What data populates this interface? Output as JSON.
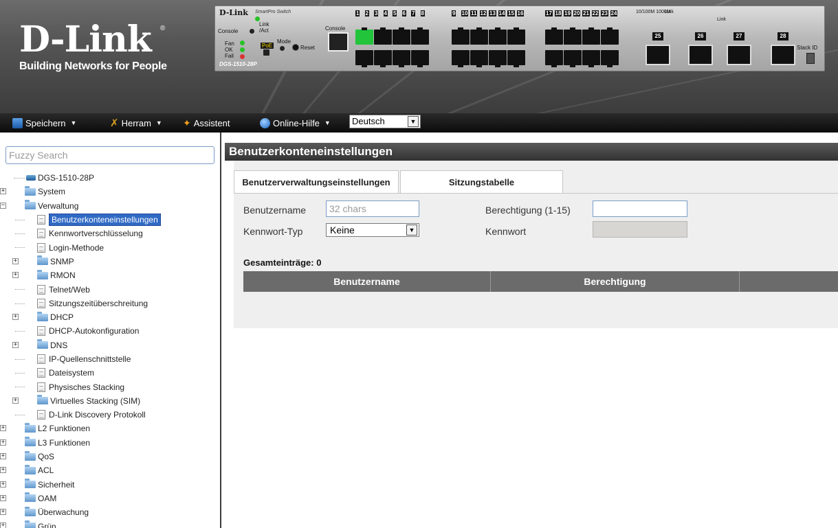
{
  "header": {
    "logo": "D-Link",
    "logo_tagline": "Building Networks for People",
    "panel_brand": "D-Link",
    "panel_brand_sub": "SmartPro Switch",
    "model": "DGS-1510-28P",
    "labels": {
      "console": "Console",
      "link": "Link",
      "act": "/Act",
      "fan": "Fan",
      "ok": "OK",
      "fail": "Fail",
      "poe": "PoE",
      "mode": "Mode",
      "reset": "Reset",
      "console_port": "Console",
      "stack_id": "Stack ID"
    },
    "port_numbers": [
      "1",
      "2",
      "3",
      "4",
      "5",
      "6",
      "7",
      "8",
      "9",
      "10",
      "11",
      "12",
      "13",
      "14",
      "15",
      "16",
      "17",
      "18",
      "19",
      "20",
      "21",
      "22",
      "23",
      "24"
    ],
    "sfp_numbers": [
      "25",
      "26",
      "27",
      "28"
    ]
  },
  "toolbar": {
    "save": "Speichern",
    "tools": "Herram",
    "wizard": "Assistent",
    "help": "Online-Hilfe",
    "language": "Deutsch"
  },
  "sidebar": {
    "search_placeholder": "Fuzzy Search",
    "root": "DGS-1510-28P",
    "items": [
      {
        "label": "System",
        "level": 0,
        "type": "folder",
        "expander": "+"
      },
      {
        "label": "Verwaltung",
        "level": 0,
        "type": "folder",
        "expander": "-"
      },
      {
        "label": "Benutzerkonteneinstellungen",
        "level": 1,
        "type": "page",
        "selected": true
      },
      {
        "label": "Kennwortverschlüsselung",
        "level": 1,
        "type": "page"
      },
      {
        "label": "Login-Methode",
        "level": 1,
        "type": "page"
      },
      {
        "label": "SNMP",
        "level": 1,
        "type": "folder",
        "expander": "+"
      },
      {
        "label": "RMON",
        "level": 1,
        "type": "folder",
        "expander": "+"
      },
      {
        "label": "Telnet/Web",
        "level": 1,
        "type": "page"
      },
      {
        "label": "Sitzungszeitüberschreitung",
        "level": 1,
        "type": "page"
      },
      {
        "label": "DHCP",
        "level": 1,
        "type": "folder",
        "expander": "+"
      },
      {
        "label": "DHCP-Autokonfiguration",
        "level": 1,
        "type": "page"
      },
      {
        "label": "DNS",
        "level": 1,
        "type": "folder",
        "expander": "+"
      },
      {
        "label": "IP-Quellenschnittstelle",
        "level": 1,
        "type": "page"
      },
      {
        "label": "Dateisystem",
        "level": 1,
        "type": "page"
      },
      {
        "label": "Physisches Stacking",
        "level": 1,
        "type": "page"
      },
      {
        "label": "Virtuelles Stacking (SIM)",
        "level": 1,
        "type": "folder",
        "expander": "+"
      },
      {
        "label": "D-Link Discovery Protokoll",
        "level": 1,
        "type": "page"
      },
      {
        "label": "L2 Funktionen",
        "level": 0,
        "type": "folder",
        "expander": "+"
      },
      {
        "label": "L3 Funktionen",
        "level": 0,
        "type": "folder",
        "expander": "+"
      },
      {
        "label": "QoS",
        "level": 0,
        "type": "folder",
        "expander": "+"
      },
      {
        "label": "ACL",
        "level": 0,
        "type": "folder",
        "expander": "+"
      },
      {
        "label": "Sicherheit",
        "level": 0,
        "type": "folder",
        "expander": "+"
      },
      {
        "label": "OAM",
        "level": 0,
        "type": "folder",
        "expander": "+"
      },
      {
        "label": "Überwachung",
        "level": 0,
        "type": "folder",
        "expander": "+"
      },
      {
        "label": "Grün",
        "level": 0,
        "type": "folder",
        "expander": "+"
      }
    ]
  },
  "main": {
    "title": "Benutzerkonteneinstellungen",
    "tabs": [
      {
        "label": "Benutzerverwaltungseinstellungen",
        "active": true
      },
      {
        "label": "Sitzungstabelle",
        "active": false
      }
    ],
    "form": {
      "username_label": "Benutzername",
      "username_placeholder": "32 chars",
      "privilege_label": "Berechtigung (1-15)",
      "privilege_value": "",
      "password_type_label": "Kennwort-Typ",
      "password_type_value": "Keine",
      "password_label": "Kennwort"
    },
    "total_entries": "Gesamteinträge: 0",
    "table_headers": [
      "Benutzername",
      "Berechtigung",
      ""
    ]
  },
  "colors": {
    "selected_bg": "#316ac5",
    "port_active": "#22c43c",
    "title_bar": "#444444",
    "table_header": "#6b6b6b"
  }
}
